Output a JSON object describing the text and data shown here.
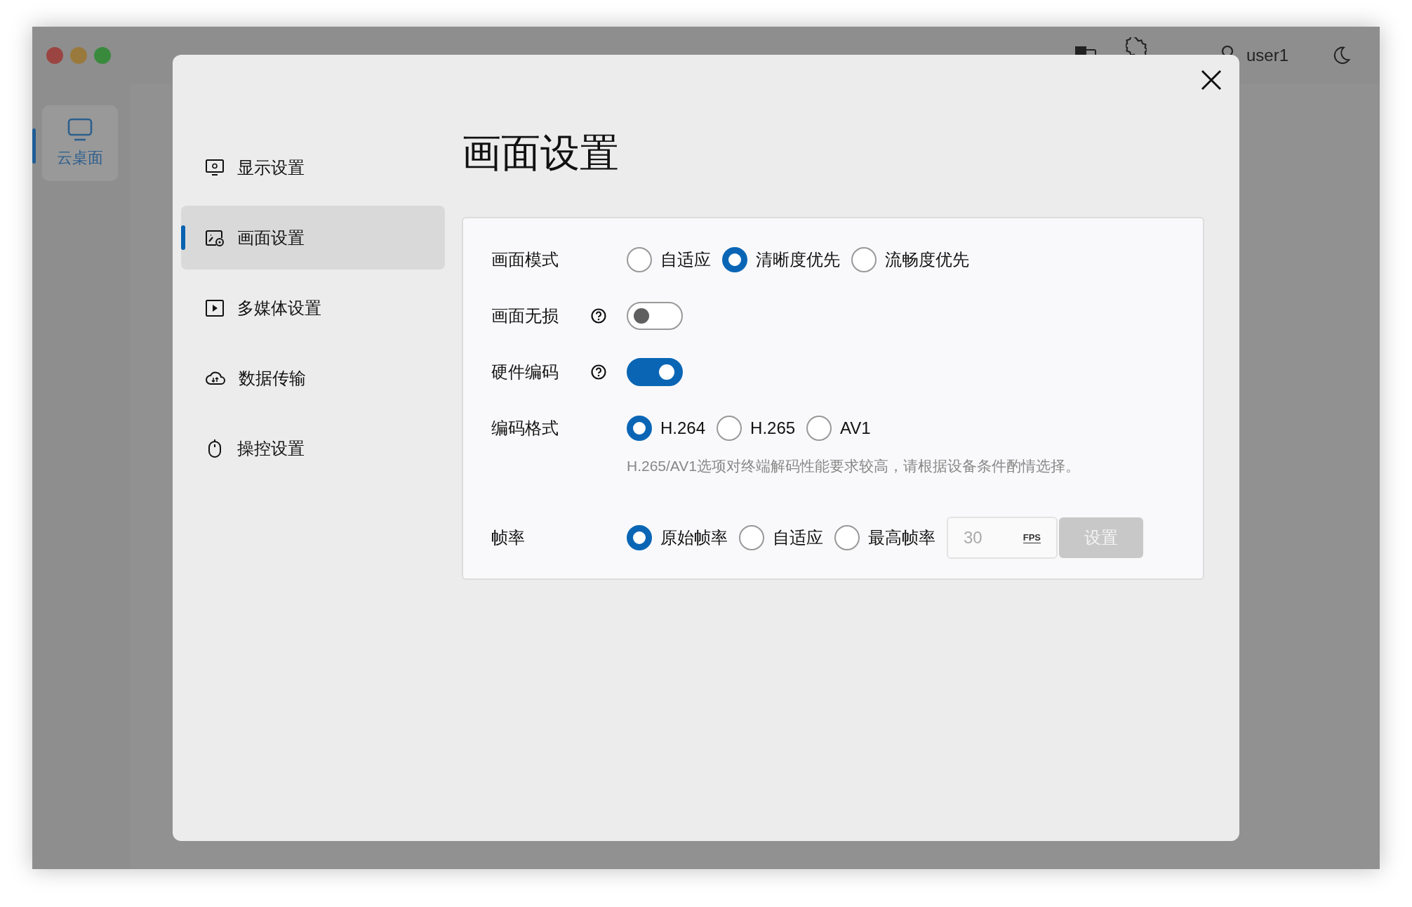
{
  "rail": {
    "items": [
      {
        "label": "云桌面",
        "selected": true
      }
    ]
  },
  "header": {
    "user": "user1"
  },
  "dialog": {
    "title": "画面设置",
    "nav": [
      {
        "label": "显示设置",
        "selected": false
      },
      {
        "label": "画面设置",
        "selected": true
      },
      {
        "label": "多媒体设置",
        "selected": false
      },
      {
        "label": "数据传输",
        "selected": false
      },
      {
        "label": "操控设置",
        "selected": false
      }
    ],
    "settings": [
      {
        "kind": "radio",
        "label": "画面模式",
        "options": [
          {
            "label": "自适应",
            "selected": false
          },
          {
            "label": "清晰度优先",
            "selected": true
          },
          {
            "label": "流畅度优先",
            "selected": false
          }
        ]
      },
      {
        "kind": "toggle",
        "label": "画面无损",
        "help": true,
        "on": false
      },
      {
        "kind": "toggle",
        "label": "硬件编码",
        "help": true,
        "on": true
      },
      {
        "kind": "radio",
        "label": "编码格式",
        "options": [
          {
            "label": "H.264",
            "selected": true
          },
          {
            "label": "H.265",
            "selected": false
          },
          {
            "label": "AV1",
            "selected": false
          }
        ],
        "hint": "H.265/AV1选项对终端解码性能要求较高，请根据设备条件酌情选择。"
      },
      {
        "kind": "radio",
        "label": "帧率",
        "options": [
          {
            "label": "原始帧率",
            "selected": true
          },
          {
            "label": "自适应",
            "selected": false
          },
          {
            "label": "最高帧率",
            "selected": false
          }
        ],
        "input": {
          "value": "30",
          "unit": "FPS",
          "disabled": true
        },
        "button": {
          "label": "设置",
          "disabled": true
        }
      }
    ]
  }
}
